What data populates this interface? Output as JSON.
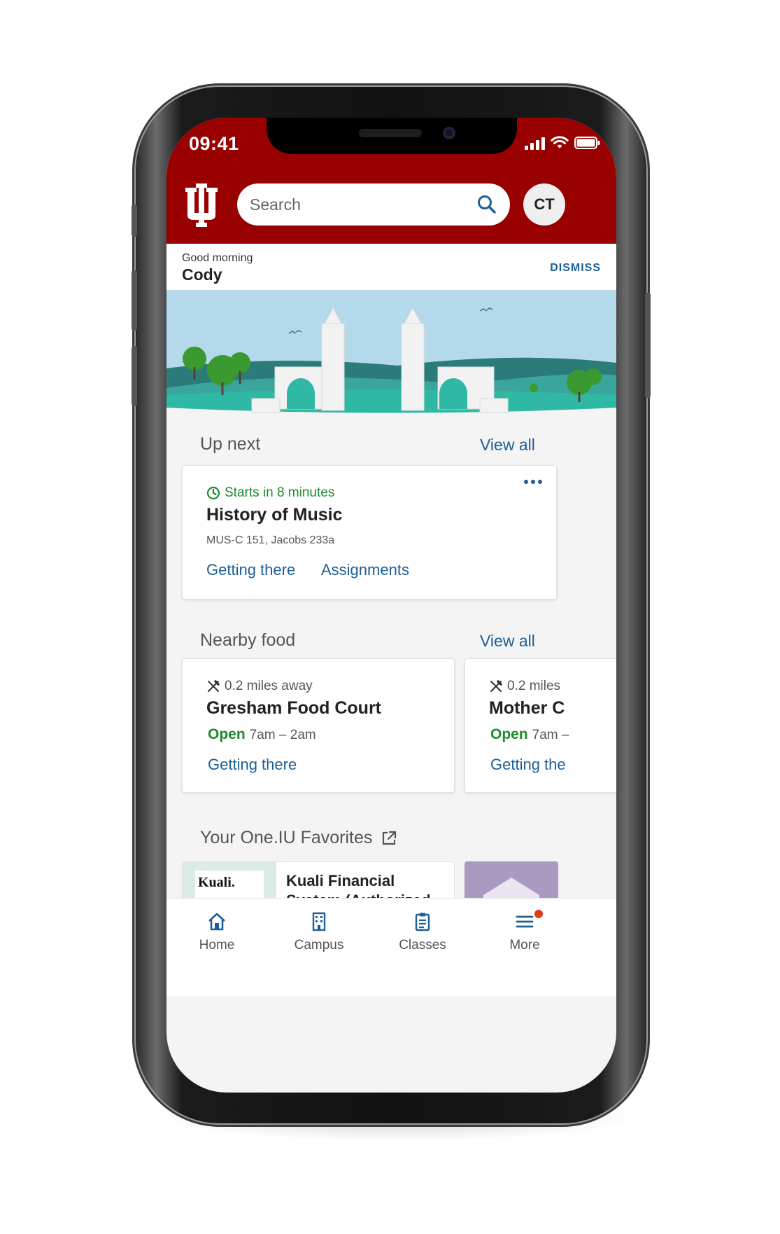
{
  "status_bar": {
    "time": "09:41"
  },
  "header": {
    "search_placeholder": "Search",
    "avatar_initials": "CT"
  },
  "greeting": {
    "salutation": "Good morning",
    "name": "Cody",
    "dismiss_label": "DISMISS"
  },
  "up_next": {
    "title": "Up next",
    "view_all": "View all",
    "card": {
      "status": "Starts in 8 minutes",
      "course": "History of Music",
      "location": "MUS-C 151, Jacobs 233a",
      "links": [
        "Getting there",
        "Assignments"
      ]
    }
  },
  "nearby_food": {
    "title": "Nearby food",
    "view_all": "View all",
    "items": [
      {
        "distance": "0.2 miles away",
        "name": "Gresham Food Court",
        "status": "Open",
        "hours": "7am – 2am",
        "link": "Getting there"
      },
      {
        "distance": "0.2 miles",
        "name": "Mother C",
        "status": "Open",
        "hours": "7am –",
        "link": "Getting the"
      }
    ]
  },
  "favorites": {
    "title": "Your One.IU Favorites",
    "items": [
      {
        "logo_text": "Kuali.",
        "name": "Kuali Financial",
        "name_line2": "System (Authorized"
      }
    ]
  },
  "tab_bar": {
    "tabs": [
      {
        "label": "Home",
        "icon": "home-icon"
      },
      {
        "label": "Campus",
        "icon": "building-icon"
      },
      {
        "label": "Classes",
        "icon": "clipboard-icon"
      },
      {
        "label": "More",
        "icon": "menu-icon"
      }
    ]
  },
  "colors": {
    "brand": "#990000",
    "link": "#1d5f97",
    "open": "#1e8a2e",
    "badge": "#e4390e"
  }
}
